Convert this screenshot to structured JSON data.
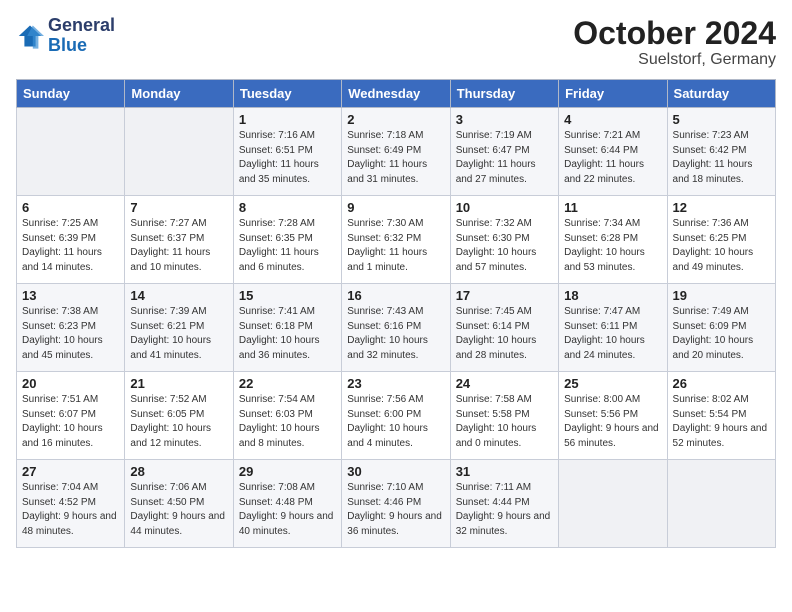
{
  "header": {
    "logo_general": "General",
    "logo_blue": "Blue",
    "title": "October 2024",
    "subtitle": "Suelstorf, Germany"
  },
  "days_of_week": [
    "Sunday",
    "Monday",
    "Tuesday",
    "Wednesday",
    "Thursday",
    "Friday",
    "Saturday"
  ],
  "weeks": [
    [
      {
        "num": "",
        "detail": ""
      },
      {
        "num": "",
        "detail": ""
      },
      {
        "num": "1",
        "detail": "Sunrise: 7:16 AM\nSunset: 6:51 PM\nDaylight: 11 hours and 35 minutes."
      },
      {
        "num": "2",
        "detail": "Sunrise: 7:18 AM\nSunset: 6:49 PM\nDaylight: 11 hours and 31 minutes."
      },
      {
        "num": "3",
        "detail": "Sunrise: 7:19 AM\nSunset: 6:47 PM\nDaylight: 11 hours and 27 minutes."
      },
      {
        "num": "4",
        "detail": "Sunrise: 7:21 AM\nSunset: 6:44 PM\nDaylight: 11 hours and 22 minutes."
      },
      {
        "num": "5",
        "detail": "Sunrise: 7:23 AM\nSunset: 6:42 PM\nDaylight: 11 hours and 18 minutes."
      }
    ],
    [
      {
        "num": "6",
        "detail": "Sunrise: 7:25 AM\nSunset: 6:39 PM\nDaylight: 11 hours and 14 minutes."
      },
      {
        "num": "7",
        "detail": "Sunrise: 7:27 AM\nSunset: 6:37 PM\nDaylight: 11 hours and 10 minutes."
      },
      {
        "num": "8",
        "detail": "Sunrise: 7:28 AM\nSunset: 6:35 PM\nDaylight: 11 hours and 6 minutes."
      },
      {
        "num": "9",
        "detail": "Sunrise: 7:30 AM\nSunset: 6:32 PM\nDaylight: 11 hours and 1 minute."
      },
      {
        "num": "10",
        "detail": "Sunrise: 7:32 AM\nSunset: 6:30 PM\nDaylight: 10 hours and 57 minutes."
      },
      {
        "num": "11",
        "detail": "Sunrise: 7:34 AM\nSunset: 6:28 PM\nDaylight: 10 hours and 53 minutes."
      },
      {
        "num": "12",
        "detail": "Sunrise: 7:36 AM\nSunset: 6:25 PM\nDaylight: 10 hours and 49 minutes."
      }
    ],
    [
      {
        "num": "13",
        "detail": "Sunrise: 7:38 AM\nSunset: 6:23 PM\nDaylight: 10 hours and 45 minutes."
      },
      {
        "num": "14",
        "detail": "Sunrise: 7:39 AM\nSunset: 6:21 PM\nDaylight: 10 hours and 41 minutes."
      },
      {
        "num": "15",
        "detail": "Sunrise: 7:41 AM\nSunset: 6:18 PM\nDaylight: 10 hours and 36 minutes."
      },
      {
        "num": "16",
        "detail": "Sunrise: 7:43 AM\nSunset: 6:16 PM\nDaylight: 10 hours and 32 minutes."
      },
      {
        "num": "17",
        "detail": "Sunrise: 7:45 AM\nSunset: 6:14 PM\nDaylight: 10 hours and 28 minutes."
      },
      {
        "num": "18",
        "detail": "Sunrise: 7:47 AM\nSunset: 6:11 PM\nDaylight: 10 hours and 24 minutes."
      },
      {
        "num": "19",
        "detail": "Sunrise: 7:49 AM\nSunset: 6:09 PM\nDaylight: 10 hours and 20 minutes."
      }
    ],
    [
      {
        "num": "20",
        "detail": "Sunrise: 7:51 AM\nSunset: 6:07 PM\nDaylight: 10 hours and 16 minutes."
      },
      {
        "num": "21",
        "detail": "Sunrise: 7:52 AM\nSunset: 6:05 PM\nDaylight: 10 hours and 12 minutes."
      },
      {
        "num": "22",
        "detail": "Sunrise: 7:54 AM\nSunset: 6:03 PM\nDaylight: 10 hours and 8 minutes."
      },
      {
        "num": "23",
        "detail": "Sunrise: 7:56 AM\nSunset: 6:00 PM\nDaylight: 10 hours and 4 minutes."
      },
      {
        "num": "24",
        "detail": "Sunrise: 7:58 AM\nSunset: 5:58 PM\nDaylight: 10 hours and 0 minutes."
      },
      {
        "num": "25",
        "detail": "Sunrise: 8:00 AM\nSunset: 5:56 PM\nDaylight: 9 hours and 56 minutes."
      },
      {
        "num": "26",
        "detail": "Sunrise: 8:02 AM\nSunset: 5:54 PM\nDaylight: 9 hours and 52 minutes."
      }
    ],
    [
      {
        "num": "27",
        "detail": "Sunrise: 7:04 AM\nSunset: 4:52 PM\nDaylight: 9 hours and 48 minutes."
      },
      {
        "num": "28",
        "detail": "Sunrise: 7:06 AM\nSunset: 4:50 PM\nDaylight: 9 hours and 44 minutes."
      },
      {
        "num": "29",
        "detail": "Sunrise: 7:08 AM\nSunset: 4:48 PM\nDaylight: 9 hours and 40 minutes."
      },
      {
        "num": "30",
        "detail": "Sunrise: 7:10 AM\nSunset: 4:46 PM\nDaylight: 9 hours and 36 minutes."
      },
      {
        "num": "31",
        "detail": "Sunrise: 7:11 AM\nSunset: 4:44 PM\nDaylight: 9 hours and 32 minutes."
      },
      {
        "num": "",
        "detail": ""
      },
      {
        "num": "",
        "detail": ""
      }
    ]
  ]
}
